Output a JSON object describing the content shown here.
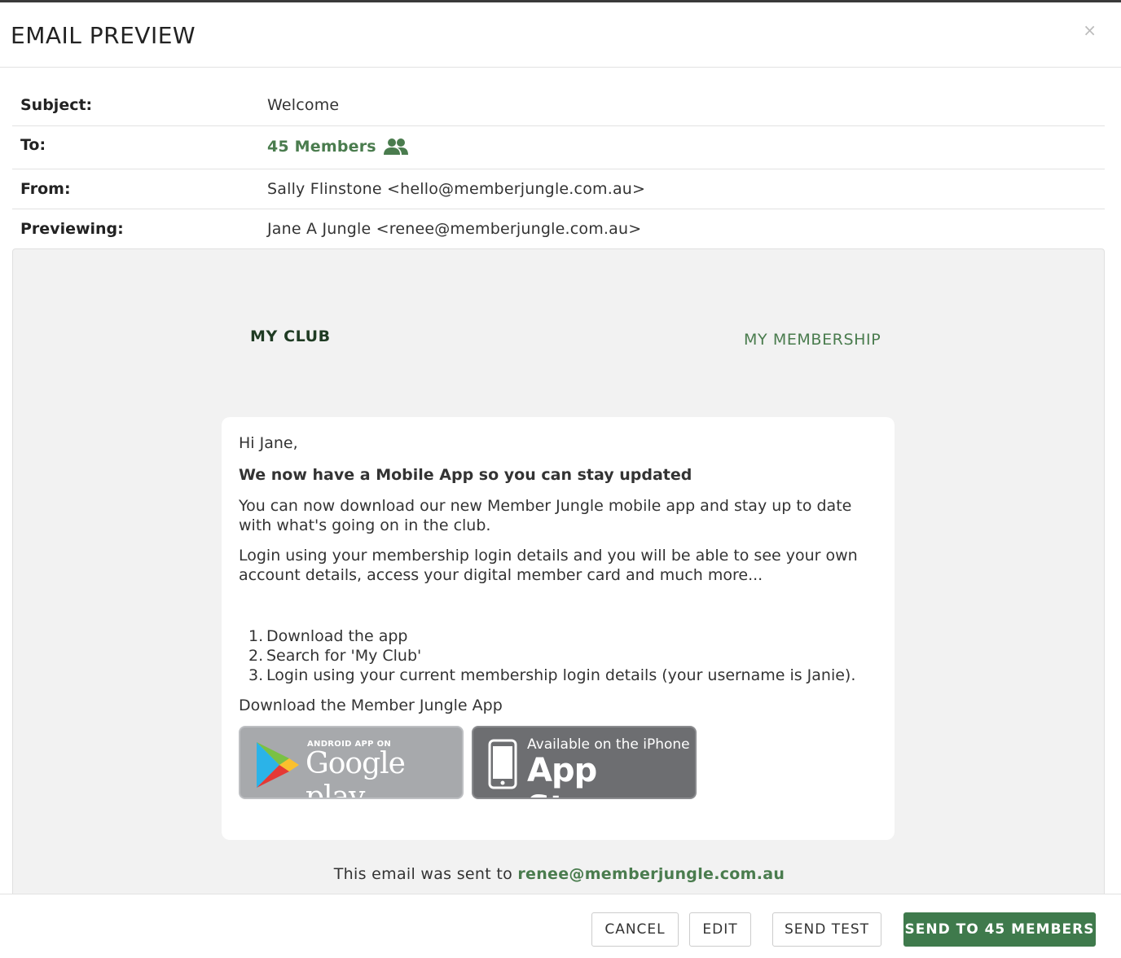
{
  "modal": {
    "title": "EMAIL PREVIEW",
    "close_label": "×"
  },
  "meta": {
    "subject_label": "Subject:",
    "subject_value": "Welcome",
    "to_label": "To:",
    "to_value": "45 Members",
    "to_icon": "people-icon",
    "from_label": "From:",
    "from_value": "Sally Flinstone <hello@memberjungle.com.au>",
    "previewing_label": "Previewing:",
    "previewing_value": "Jane A Jungle <renee@memberjungle.com.au>"
  },
  "email": {
    "club_name": "MY CLUB",
    "membership_link": "MY MEMBERSHIP",
    "greeting": "Hi Jane,",
    "headline": "We now have a Mobile App so you can stay updated",
    "para1": "You can now download our new Member Jungle mobile app and stay up to date with what's going on in the club.",
    "para2": "Login using your membership login details and you will be able to see your own account details, access your digital member card and much more...",
    "steps": [
      {
        "num": "1.",
        "text": "Download the app"
      },
      {
        "num": "2.",
        "text": "Search for 'My Club'"
      },
      {
        "num": "3.",
        "text": "Login using your current membership login details (your username is Janie)."
      }
    ],
    "download_label": "Download the Member Jungle App",
    "google_badge": {
      "small": "ANDROID APP ON",
      "big": "Google play"
    },
    "apple_badge": {
      "small": "Available on the iPhone",
      "big": "App Store"
    },
    "footer_prefix": "This email was sent to ",
    "footer_email": "renee@memberjungle.com.au"
  },
  "footer": {
    "cancel": "CANCEL",
    "edit": "EDIT",
    "send_test": "SEND TEST",
    "send_all": "SEND TO 45 MEMBERS"
  },
  "colors": {
    "accent_green": "#4a7c4e",
    "primary_button": "#3f7a4c",
    "club_name_dark_green": "#1f3b23",
    "preview_background": "#f2f2f2"
  }
}
